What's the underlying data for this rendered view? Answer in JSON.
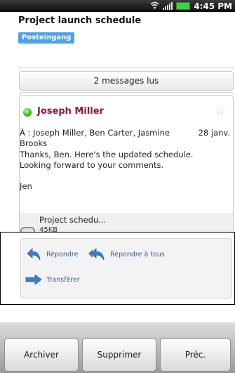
{
  "status_bar": {
    "time": "4:45 PM",
    "icons": [
      "wifi-icon",
      "signal-icon",
      "battery-icon"
    ],
    "battery_color": "#3fcf3f"
  },
  "message": {
    "subject": "Project launch schedule",
    "folder": "Posteingang",
    "folder_color": "#4ba3e8",
    "read_summary": "2 messages lus",
    "sender": "Joseph Miller",
    "sender_color": "#8b1a3a",
    "recipients_line1": "À : Joseph Miller, Ben Carter, Jasmine",
    "recipients_line2": "Brooks",
    "date": "28 janv.",
    "body_lines": [
      "Thanks, Ben. Here's the updated schedule.",
      "Looking forward to your comments.",
      "",
      "Jen"
    ],
    "attachment": {
      "name": "Project schedu...",
      "size": "45KB"
    }
  },
  "actions": {
    "reply": "Répondre",
    "reply_all": "Répondre à tous",
    "forward": "Transférer"
  },
  "toolbar": {
    "archive": "Archiver",
    "delete": "Supprimer",
    "previous": "Préc."
  }
}
